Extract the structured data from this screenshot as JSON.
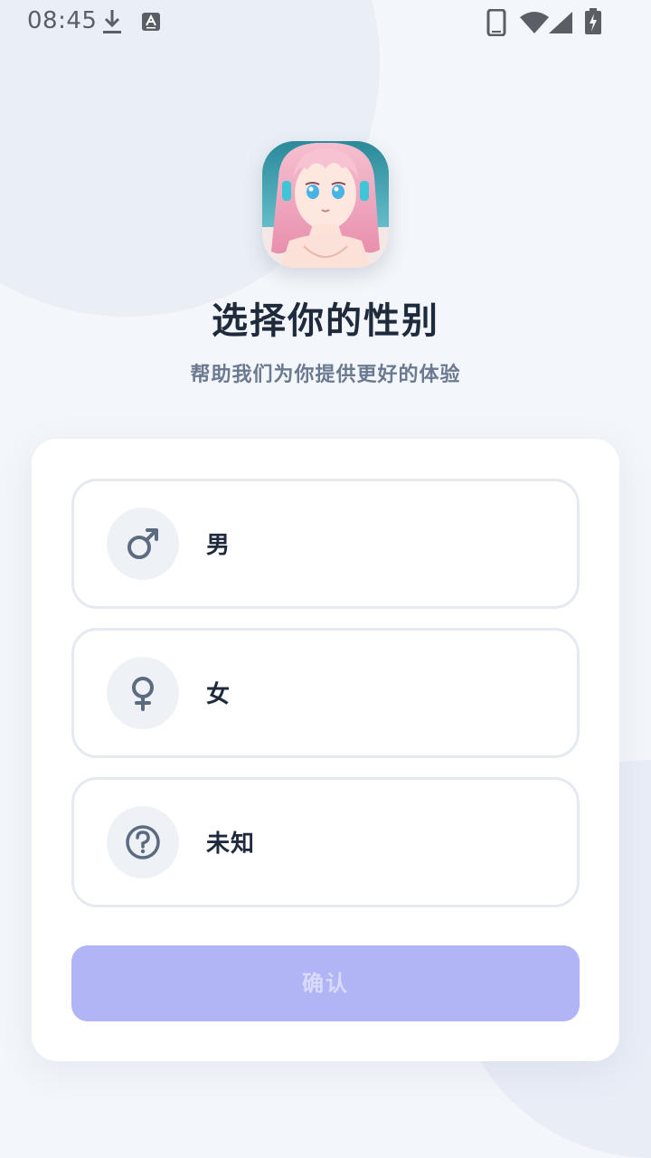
{
  "status_bar": {
    "time": "08:45",
    "icons": [
      "download-icon",
      "keyboard-a-icon",
      "phone-icon",
      "wifi-icon",
      "signal-icon",
      "battery-charging-icon"
    ]
  },
  "header": {
    "app_icon": "app-avatar-anime-girl",
    "title": "选择你的性别",
    "subtitle": "帮助我们为你提供更好的体验"
  },
  "options": [
    {
      "label": "男",
      "icon": "male-icon"
    },
    {
      "label": "女",
      "icon": "female-icon"
    },
    {
      "label": "未知",
      "icon": "question-icon"
    }
  ],
  "confirm": {
    "label": "确认",
    "state": "disabled"
  },
  "colors": {
    "background": "#f3f6fa",
    "card": "#ffffff",
    "border": "#e5eaf1",
    "title": "#1f2a3c",
    "subtitle": "#6b7a90",
    "icon": "#5c6b80",
    "button_disabled": "#b1b5f5"
  }
}
